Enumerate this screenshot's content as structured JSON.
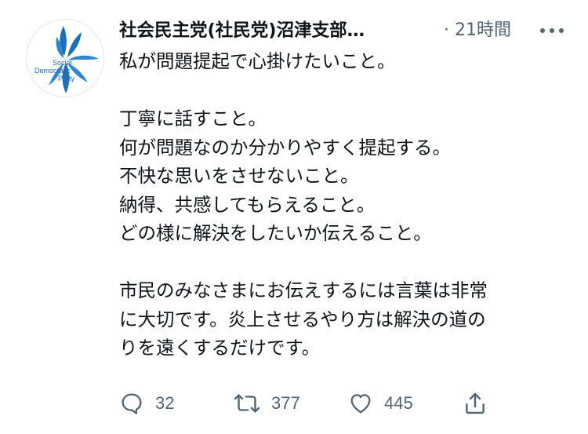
{
  "tweet": {
    "avatar": {
      "logo_lines": [
        "Social",
        "Democratic",
        "Party"
      ]
    },
    "display_name": "社会民主党(社民党)沼津支部…",
    "timestamp": "· 21時間",
    "body_lines": [
      "私が問題提起で心掛けたいこと。",
      "",
      "丁寧に話すこと。",
      "何が問題なのか分かりやすく提起する。",
      "不快な思いをさせないこと。",
      "納得、共感してもらえること。",
      "どの様に解決をしたいか伝えること。",
      "",
      "市民のみなさまにお伝えするには言葉は非常",
      "に大切です。炎上させるやり方は解決の道の",
      "りを遠くするだけです。"
    ],
    "actions": {
      "reply_count": "32",
      "retweet_count": "377",
      "like_count": "445"
    },
    "colors": {
      "text": "#0f1419",
      "muted": "#536471",
      "logo_blue": "#1d6fb8"
    }
  }
}
